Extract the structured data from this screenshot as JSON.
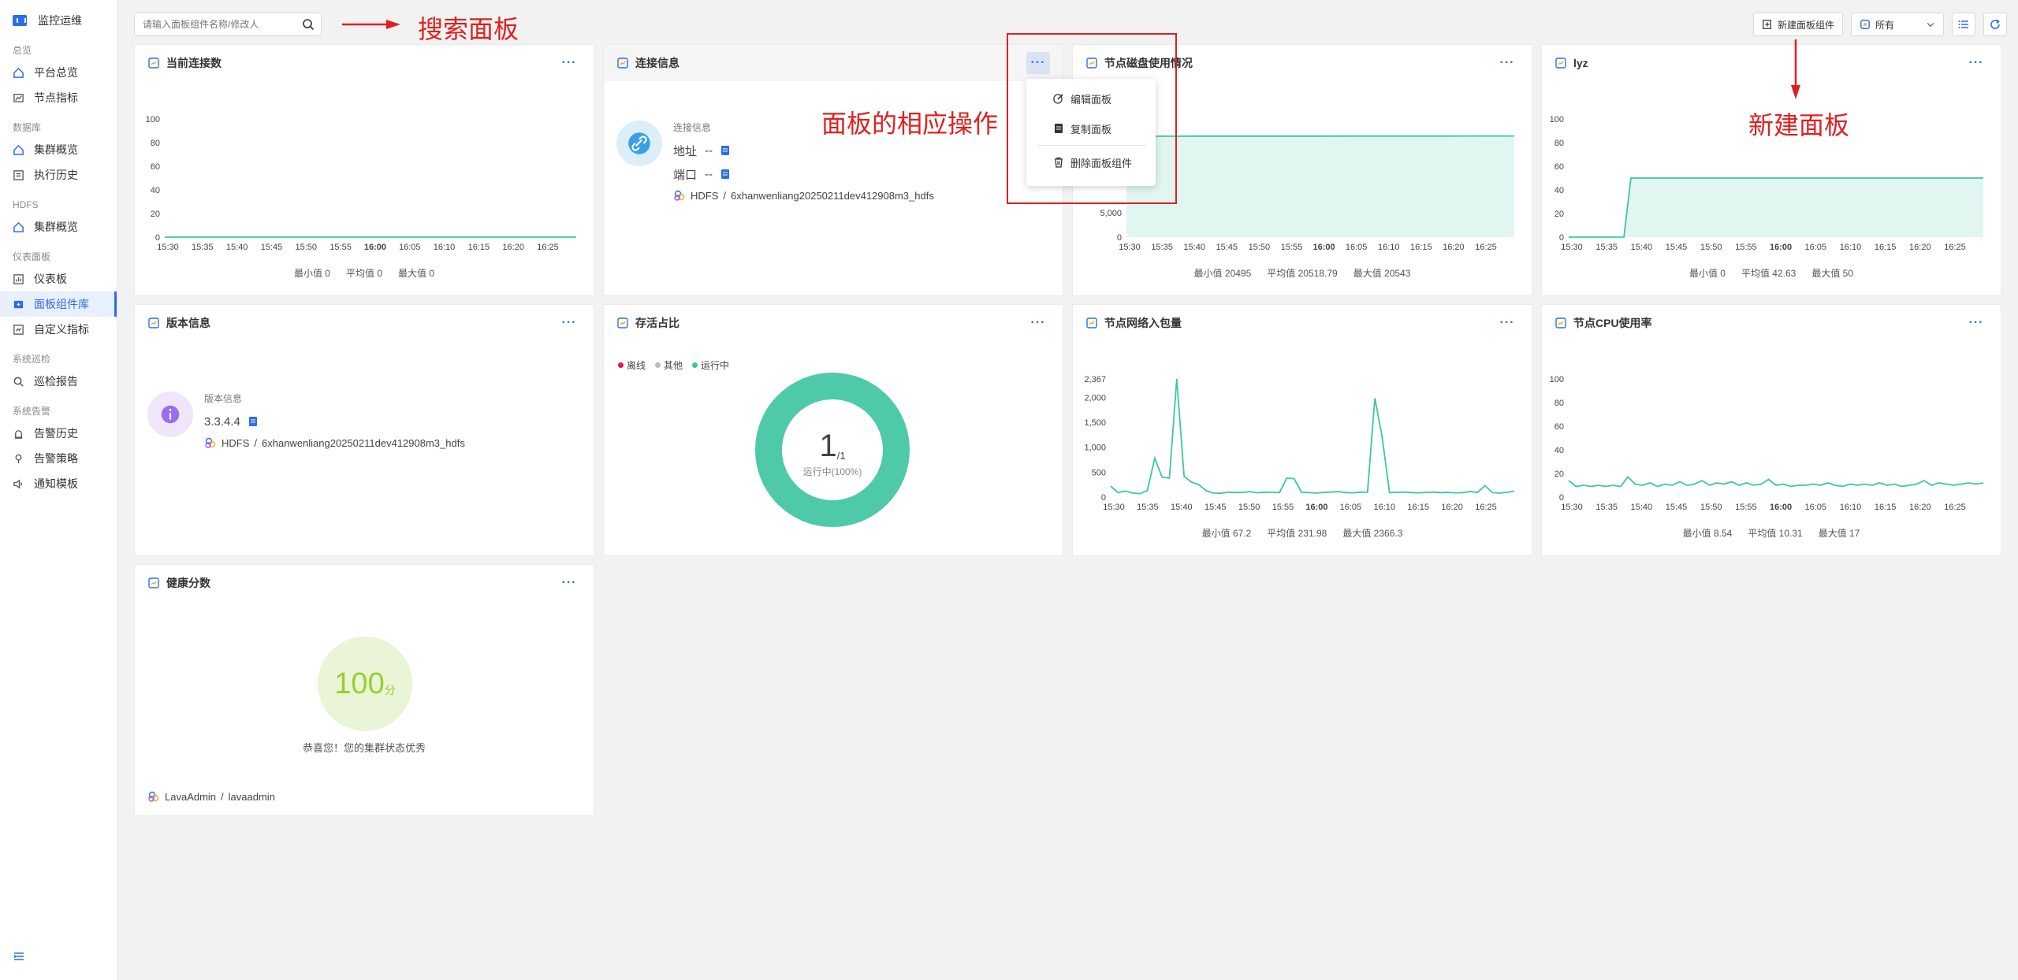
{
  "sidebar": {
    "brand": "监控运维",
    "groups": [
      {
        "title": "总览",
        "items": [
          "平台总览",
          "节点指标"
        ]
      },
      {
        "title": "数据库",
        "items": [
          "集群概览",
          "执行历史"
        ]
      },
      {
        "title": "HDFS",
        "items": [
          "集群概览"
        ]
      },
      {
        "title": "仪表面板",
        "items": [
          "仪表板",
          "面板组件库",
          "自定义指标"
        ]
      },
      {
        "title": "系统巡检",
        "items": [
          "巡检报告"
        ]
      },
      {
        "title": "系统告警",
        "items": [
          "告警历史",
          "告警策略",
          "通知模板"
        ]
      }
    ],
    "active": "面板组件库"
  },
  "topbar": {
    "search_placeholder": "请输入面板组件名称/修改人",
    "new_button": "新建面板组件",
    "filter_value": "所有"
  },
  "annotations": {
    "search": "搜索面板",
    "actions": "面板的相应操作",
    "create": "新建面板"
  },
  "menu": {
    "edit": "编辑面板",
    "copy": "复制面板",
    "delete": "删除面板组件"
  },
  "time_ticks": [
    "15:30",
    "15:35",
    "15:40",
    "15:45",
    "15:50",
    "15:55",
    "16:00",
    "16:05",
    "16:10",
    "16:15",
    "16:20",
    "16:25"
  ],
  "cards": {
    "connections": {
      "title": "当前连接数",
      "min": "最小值 0",
      "avg": "平均值 0",
      "max": "最大值 0"
    },
    "conn_info": {
      "title": "连接信息",
      "label": "连接信息",
      "addr_label": "地址",
      "addr_value": "--",
      "port_label": "端口",
      "port_value": "--",
      "service": "HDFS",
      "sep": "/",
      "cluster": "6xhanwenliang20250211dev412908m3_hdfs"
    },
    "disk": {
      "title": "节点磁盘使用情况",
      "min": "最小值 20495",
      "avg": "平均值 20518.79",
      "max": "最大值 20543"
    },
    "lyz": {
      "title": "lyz",
      "min": "最小值 0",
      "avg": "平均值 42.63",
      "max": "最大值 50"
    },
    "version": {
      "title": "版本信息",
      "label": "版本信息",
      "value": "3.3.4.4",
      "service": "HDFS",
      "sep": "/",
      "cluster": "6xhanwenliang20250211dev412908m3_hdfs"
    },
    "alive": {
      "title": "存活占比",
      "legend_offline": "离线",
      "legend_other": "其他",
      "legend_running": "运行中",
      "big": "1",
      "sub": "/1",
      "caption": "运行中(100%)"
    },
    "net": {
      "title": "节点网络入包量",
      "min": "最小值 67.2",
      "avg": "平均值 231.98",
      "max": "最大值 2366.3"
    },
    "cpu": {
      "title": "节点CPU使用率",
      "min": "最小值 8.54",
      "avg": "平均值 10.31",
      "max": "最大值 17"
    },
    "health": {
      "title": "健康分数",
      "score": "100",
      "unit": "分",
      "message": "恭喜您！您的集群状态优秀",
      "user": "LavaAdmin",
      "sep": "/",
      "login": "lavaadmin"
    }
  },
  "chart_data": [
    {
      "type": "line",
      "title": "当前连接数",
      "x": [
        "15:30",
        "15:35",
        "15:40",
        "15:45",
        "15:50",
        "15:55",
        "16:00",
        "16:05",
        "16:10",
        "16:15",
        "16:20",
        "16:25"
      ],
      "yticks": [
        "0",
        "20",
        "40",
        "60",
        "80",
        "100"
      ],
      "ylim": [
        0,
        100
      ],
      "series": [
        {
          "values": [
            0,
            0,
            0,
            0,
            0,
            0,
            0,
            0,
            0,
            0,
            0,
            0,
            0
          ]
        }
      ]
    },
    {
      "type": "area",
      "title": "节点磁盘使用情况",
      "x": [
        "15:30",
        "15:35",
        "15:40",
        "15:45",
        "15:50",
        "15:55",
        "16:00",
        "16:05",
        "16:10",
        "16:15",
        "16:20",
        "16:25"
      ],
      "yticks": [
        "0",
        "5,000"
      ],
      "series": [
        {
          "values": [
            20495,
            20500,
            20505,
            20510,
            20512,
            20515,
            20518,
            20522,
            20527,
            20531,
            20536,
            20540,
            20543
          ]
        }
      ]
    },
    {
      "type": "area",
      "title": "lyz",
      "x": [
        "15:30",
        "15:35",
        "15:40",
        "15:45",
        "15:50",
        "15:55",
        "16:00",
        "16:05",
        "16:10",
        "16:15",
        "16:20",
        "16:25"
      ],
      "yticks": [
        "0",
        "20",
        "40",
        "60",
        "80",
        "100"
      ],
      "ylim": [
        0,
        100
      ],
      "series": [
        {
          "values": [
            0,
            0,
            0,
            0,
            0,
            0,
            0,
            0,
            0,
            50,
            50,
            50,
            50,
            50,
            50,
            50,
            50,
            50,
            50,
            50,
            50,
            50,
            50,
            50,
            50,
            50,
            50,
            50,
            50,
            50,
            50,
            50,
            50,
            50,
            50,
            50,
            50,
            50,
            50,
            50,
            50,
            50,
            50,
            50,
            50,
            50,
            50,
            50,
            50,
            50,
            50,
            50,
            50,
            50,
            50,
            50,
            50,
            50,
            50,
            50,
            50
          ]
        }
      ]
    },
    {
      "type": "line",
      "title": "节点网络入包量",
      "x": [
        "15:30",
        "15:35",
        "15:40",
        "15:45",
        "15:50",
        "15:55",
        "16:00",
        "16:05",
        "16:10",
        "16:15",
        "16:20",
        "16:25"
      ],
      "yticks": [
        "0",
        "500",
        "1,000",
        "1,500",
        "2,000",
        "2,367"
      ],
      "ylim": [
        0,
        2367
      ],
      "series": [
        {
          "values": [
            220,
            90,
            120,
            80,
            70,
            130,
            780,
            400,
            380,
            2366,
            420,
            300,
            250,
            130,
            80,
            75,
            100,
            90,
            95,
            110,
            85,
            100,
            95,
            90,
            380,
            370,
            100,
            90,
            80,
            95,
            100,
            110,
            90,
            85,
            100,
            95,
            1980,
            1200,
            90,
            95,
            100,
            90,
            85,
            95,
            100,
            90,
            95,
            85,
            90,
            110,
            95,
            230,
            90,
            80,
            95,
            120
          ]
        }
      ]
    },
    {
      "type": "line",
      "title": "节点CPU使用率",
      "x": [
        "15:30",
        "15:35",
        "15:40",
        "15:45",
        "15:50",
        "15:55",
        "16:00",
        "16:05",
        "16:10",
        "16:15",
        "16:20",
        "16:25"
      ],
      "yticks": [
        "0",
        "20",
        "40",
        "60",
        "80",
        "100"
      ],
      "ylim": [
        0,
        100
      ],
      "series": [
        {
          "values": [
            14,
            9,
            10,
            9,
            10,
            9,
            10,
            9,
            17,
            11,
            10,
            12,
            9,
            11,
            10,
            13,
            10,
            11,
            14,
            10,
            12,
            11,
            13,
            10,
            12,
            10,
            11,
            15,
            10,
            11,
            9,
            10,
            10,
            11,
            10,
            12,
            10,
            9,
            11,
            10,
            11,
            10,
            12,
            10,
            11,
            9,
            10,
            11,
            14,
            10,
            12,
            11,
            10,
            11,
            12,
            11,
            12
          ]
        }
      ]
    },
    {
      "type": "pie",
      "title": "存活占比",
      "categories": [
        "离线",
        "其他",
        "运行中"
      ],
      "values": [
        0,
        0,
        1
      ]
    }
  ],
  "colors": {
    "accent": "#2d6ee6",
    "series": "#3cc7a0",
    "area": "#d9f4ec",
    "annot": "#e02020"
  }
}
